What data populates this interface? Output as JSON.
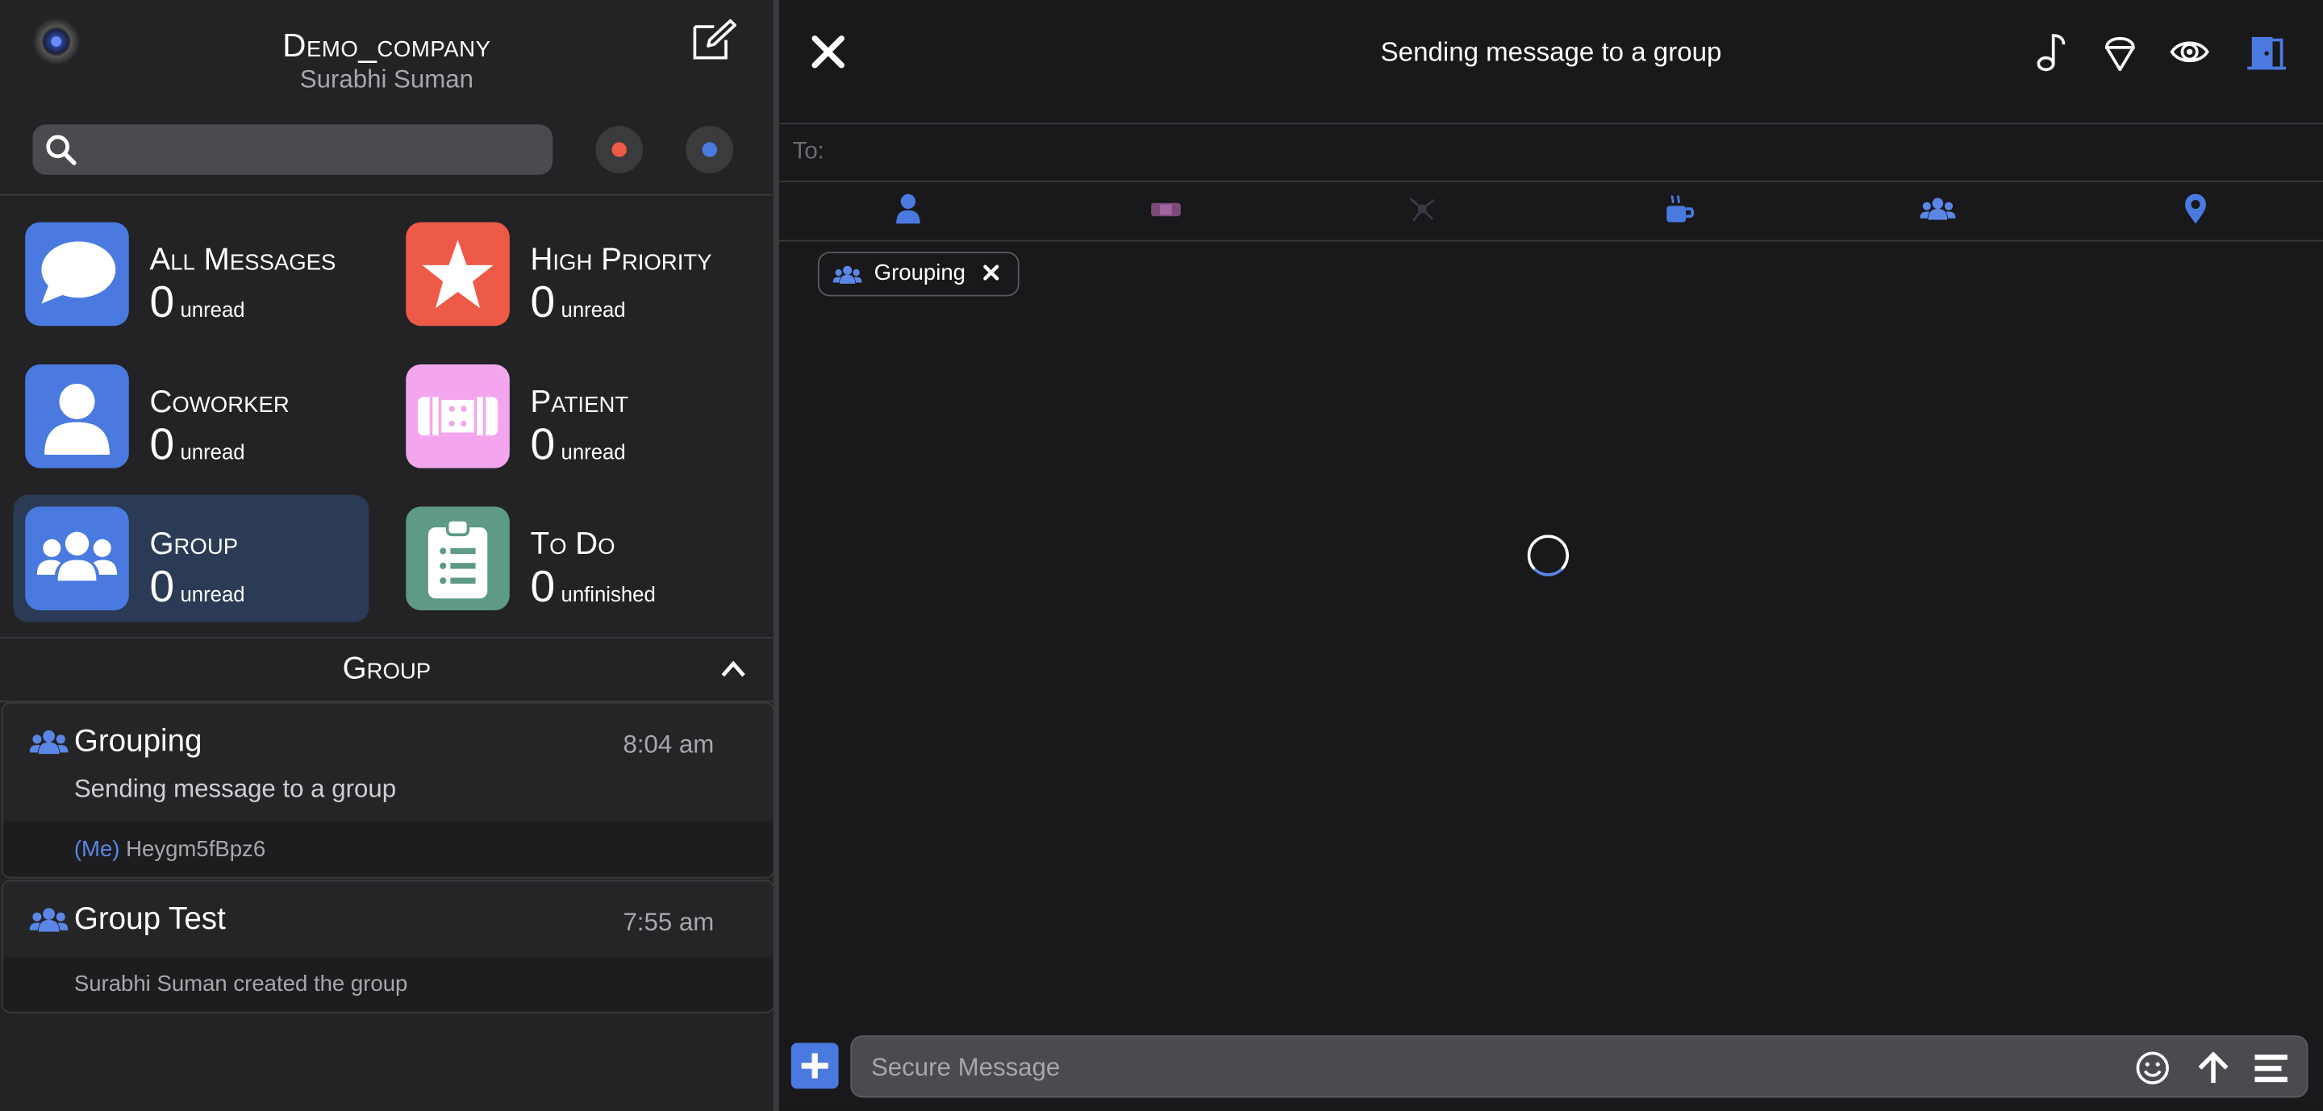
{
  "sidebar": {
    "company": "Demo_company",
    "user": "Surabhi Suman",
    "search": {
      "placeholder": ""
    },
    "status_dots": {
      "red": "#ef5a44",
      "blue": "#4a7ae0"
    },
    "categories": [
      {
        "title": "All Messages",
        "count": "0",
        "unit": "unread",
        "color": "#4a7ae0",
        "icon": "speech-bubble-icon"
      },
      {
        "title": "High Priority",
        "count": "0",
        "unit": "unread",
        "color": "#ee5a48",
        "icon": "star-icon"
      },
      {
        "title": "Coworker",
        "count": "0",
        "unit": "unread",
        "color": "#4a7ae0",
        "icon": "person-icon"
      },
      {
        "title": "Patient",
        "count": "0",
        "unit": "unread",
        "color": "#f3a6ee",
        "icon": "bandage-icon"
      },
      {
        "title": "Group",
        "count": "0",
        "unit": "unread",
        "color": "#4a7ae0",
        "icon": "group-icon",
        "selected": true
      },
      {
        "title": "To Do",
        "count": "0",
        "unit": "unfinished",
        "color": "#5e9a86",
        "icon": "clipboard-icon"
      }
    ],
    "section_title": "Group",
    "conversations": [
      {
        "name": "Grouping",
        "time": "8:04 am",
        "subject": "Sending message to a group",
        "me_label": "(Me)",
        "preview": "Heygm5fBpz6"
      },
      {
        "name": "Group Test",
        "time": "7:55 am",
        "preview": "Surabhi Suman created the group"
      }
    ]
  },
  "compose_panel": {
    "title": "Sending message to a group",
    "to_label": "To:",
    "recipient_chip": "Grouping",
    "header_icons": [
      "music-note-icon",
      "ice-cream-icon",
      "eye-icon",
      "door-exit-icon"
    ],
    "contact_type_icons": [
      "person-icon",
      "bandage-icon",
      "network-icon",
      "coffee-icon",
      "group-icon",
      "location-pin-icon"
    ],
    "message_placeholder": "Secure Message",
    "accent": "#4a7ae0"
  }
}
